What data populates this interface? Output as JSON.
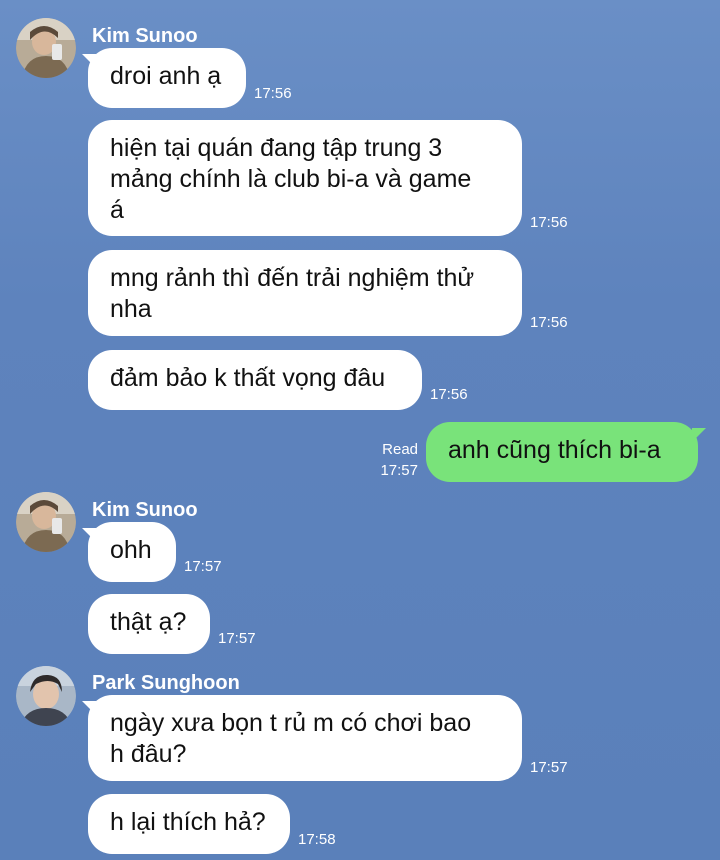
{
  "chat": {
    "messages": [
      {
        "sender": "Kim Sunoo",
        "text": "droi anh ạ",
        "time": "17:56"
      },
      {
        "text_lines": [
          "hiện tại quán đang tập trung 3",
          "mảng chính là club bi-a và game",
          "á"
        ],
        "time": "17:56"
      },
      {
        "text_lines": [
          "mng rảnh thì đến trải nghiệm thử",
          "nha"
        ],
        "time": "17:56"
      },
      {
        "text": "đảm bảo k thất vọng đâu",
        "time": "17:56"
      },
      {
        "outgoing": true,
        "text": "anh cũng thích bi-a",
        "read_label": "Read",
        "time": "17:57"
      },
      {
        "sender": "Kim Sunoo",
        "text": "ohh",
        "time": "17:57"
      },
      {
        "text": "thật ạ?",
        "time": "17:57"
      },
      {
        "sender": "Park Sunghoon",
        "text_lines": [
          "ngày xưa bọn t rủ m có chơi bao",
          "h đâu?"
        ],
        "time": "17:57"
      },
      {
        "text": "h lại thích hả?",
        "time": "17:58"
      }
    ]
  },
  "colors": {
    "background": "#5e83bd",
    "incoming_bubble": "#ffffff",
    "outgoing_bubble": "#79e37a"
  }
}
